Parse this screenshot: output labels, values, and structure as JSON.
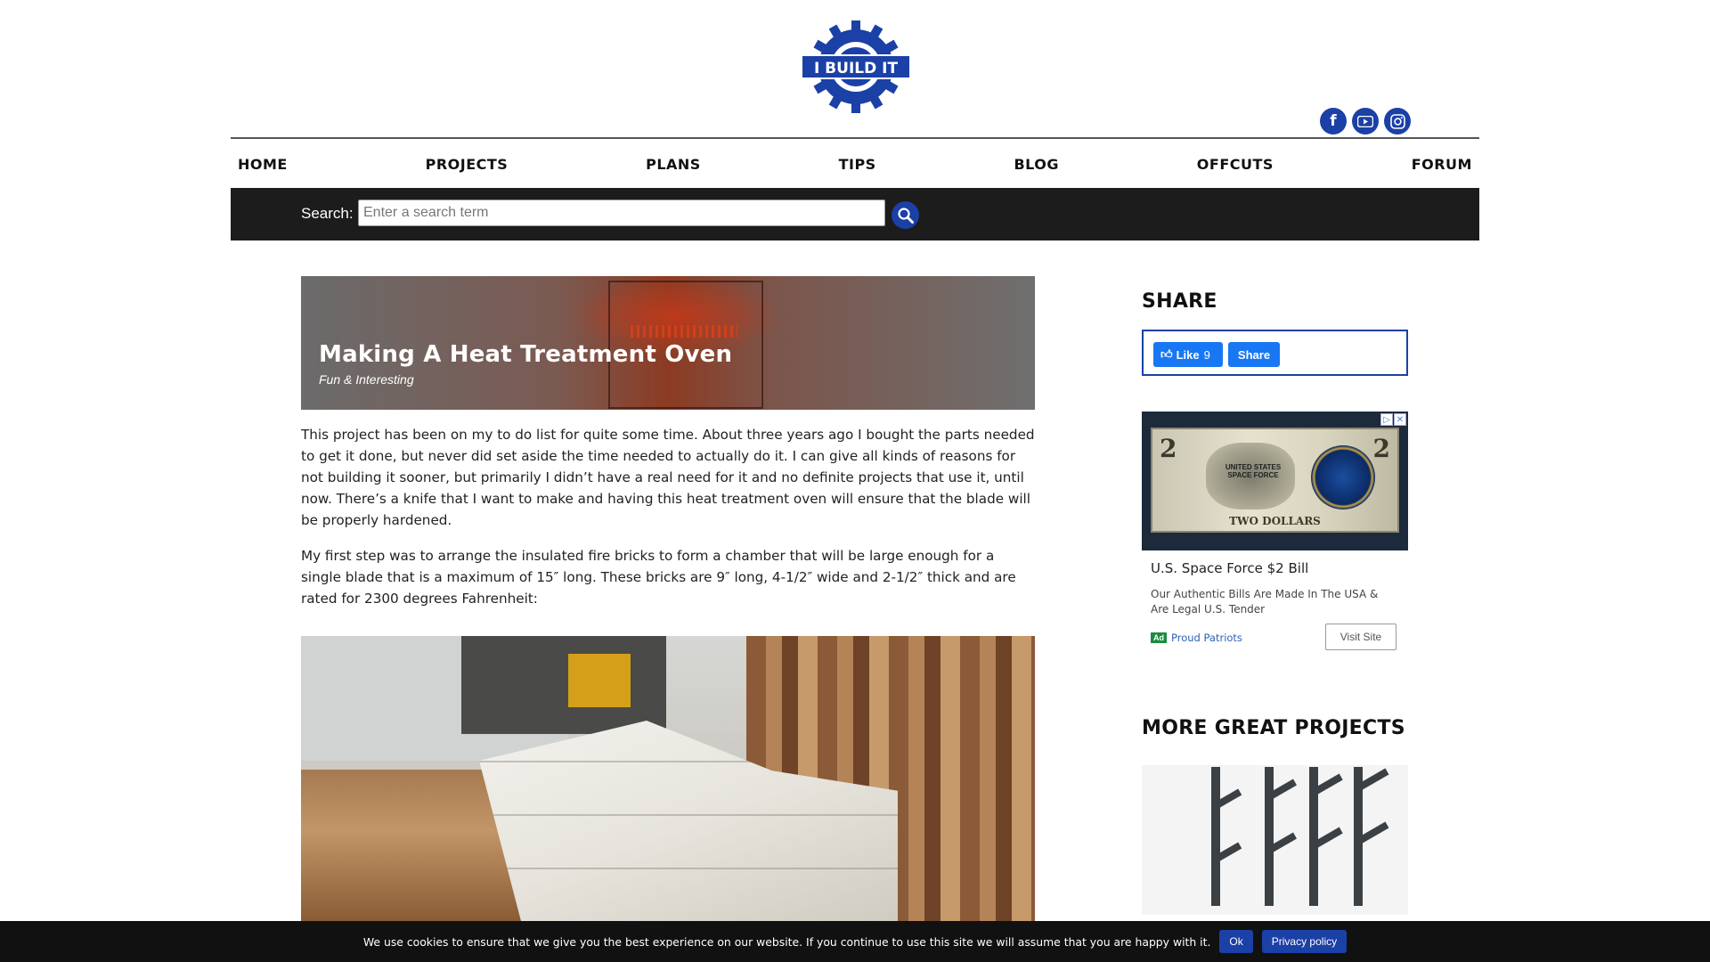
{
  "site": {
    "logo_text": "I BUILD IT"
  },
  "social": [
    "facebook-icon",
    "youtube-icon",
    "instagram-icon"
  ],
  "nav": {
    "items": [
      "HOME",
      "PROJECTS",
      "PLANS",
      "TIPS",
      "BLOG",
      "OFFCUTS",
      "FORUM"
    ]
  },
  "search": {
    "label": "Search:",
    "placeholder": "Enter a search term"
  },
  "hero": {
    "title": "Making A Heat Treatment Oven",
    "category": "Fun & Interesting"
  },
  "article": {
    "p1": "This project has been on my to do list for quite some time. About three years ago I bought the parts needed to get it done, but never did set aside the time needed to actually do it. I can give all kinds of reasons for not building it sooner, but primarily I didn’t have a real need for it and no definite projects that use it, until now. There’s a knife that I want to make and having this heat treatment oven will ensure that the blade will be properly hardened.",
    "p2": "My first step was to arrange the insulated fire bricks to form a chamber that will be large enough for a single blade that is a maximum of 15″ long. These bricks are 9″ long, 4-1/2″ wide and 2-1/2″ thick and are rated for 2300 degrees Fahrenheit:"
  },
  "sidebar": {
    "share_title": "SHARE",
    "like_label": "Like",
    "like_count": "9",
    "share_label": "Share",
    "more_title": "MORE GREAT PROJECTS"
  },
  "ad": {
    "headline": "U.S. Space Force $2 Bill",
    "body": "Our Authentic Bills Are Made In The USA & Are Legal U.S. Tender",
    "badge": "Ad",
    "advertiser": "Proud Patriots",
    "cta": "Visit Site",
    "bill_denomination": "2",
    "bill_text": "TWO DOLLARS",
    "bill_branch": "UNITED STATES SPACE FORCE"
  },
  "cookie": {
    "text": "We use cookies to ensure that we give you the best experience on our website. If you continue to use this site we will assume that you are happy with it.",
    "ok": "Ok",
    "privacy": "Privacy policy"
  },
  "colors": {
    "brand_blue": "#1b40a6",
    "nav_text": "#111111",
    "search_bar": "#1c1c1c",
    "cookie_bar": "#111111"
  }
}
